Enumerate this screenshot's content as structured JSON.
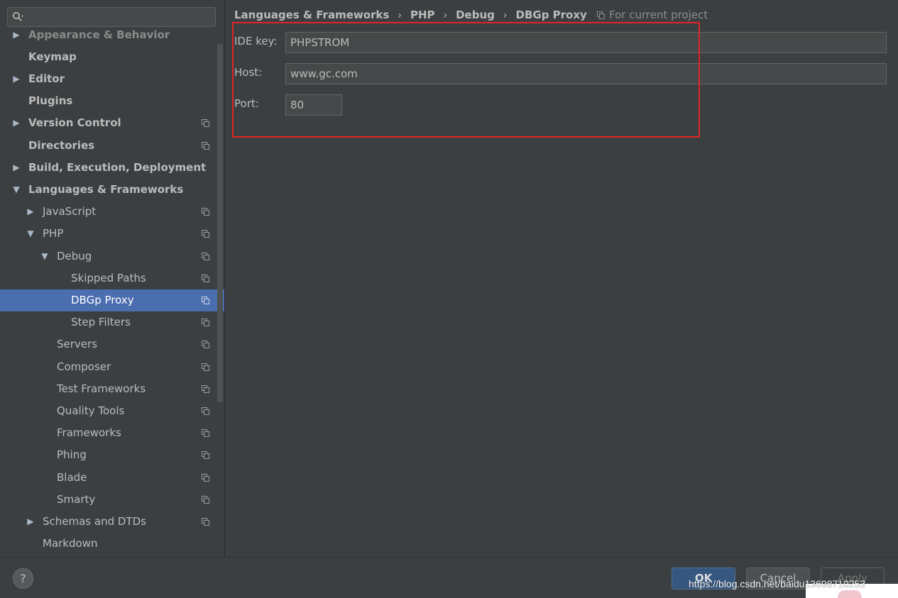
{
  "search": {
    "placeholder": ""
  },
  "sidebar": {
    "items": [
      {
        "label": "Appearance & Behavior",
        "arrow": "▶",
        "indent": 0,
        "bold": true,
        "proj": false,
        "cut": true
      },
      {
        "label": "Keymap",
        "arrow": "",
        "indent": 0,
        "bold": true,
        "proj": false
      },
      {
        "label": "Editor",
        "arrow": "▶",
        "indent": 0,
        "bold": true,
        "proj": false
      },
      {
        "label": "Plugins",
        "arrow": "",
        "indent": 0,
        "bold": true,
        "proj": false
      },
      {
        "label": "Version Control",
        "arrow": "▶",
        "indent": 0,
        "bold": true,
        "proj": true
      },
      {
        "label": "Directories",
        "arrow": "",
        "indent": 0,
        "bold": true,
        "proj": true
      },
      {
        "label": "Build, Execution, Deployment",
        "arrow": "▶",
        "indent": 0,
        "bold": true,
        "proj": false
      },
      {
        "label": "Languages & Frameworks",
        "arrow": "▼",
        "indent": 0,
        "bold": true,
        "proj": false
      },
      {
        "label": "JavaScript",
        "arrow": "▶",
        "indent": 1,
        "bold": false,
        "proj": true
      },
      {
        "label": "PHP",
        "arrow": "▼",
        "indent": 1,
        "bold": false,
        "proj": true
      },
      {
        "label": "Debug",
        "arrow": "▼",
        "indent": 2,
        "bold": false,
        "proj": true
      },
      {
        "label": "Skipped Paths",
        "arrow": "",
        "indent": 3,
        "bold": false,
        "proj": true
      },
      {
        "label": "DBGp Proxy",
        "arrow": "",
        "indent": 3,
        "bold": false,
        "proj": true,
        "selected": true
      },
      {
        "label": "Step Filters",
        "arrow": "",
        "indent": 3,
        "bold": false,
        "proj": true
      },
      {
        "label": "Servers",
        "arrow": "",
        "indent": 2,
        "bold": false,
        "proj": true
      },
      {
        "label": "Composer",
        "arrow": "",
        "indent": 2,
        "bold": false,
        "proj": true
      },
      {
        "label": "Test Frameworks",
        "arrow": "",
        "indent": 2,
        "bold": false,
        "proj": true
      },
      {
        "label": "Quality Tools",
        "arrow": "",
        "indent": 2,
        "bold": false,
        "proj": true
      },
      {
        "label": "Frameworks",
        "arrow": "",
        "indent": 2,
        "bold": false,
        "proj": true
      },
      {
        "label": "Phing",
        "arrow": "",
        "indent": 2,
        "bold": false,
        "proj": true
      },
      {
        "label": "Blade",
        "arrow": "",
        "indent": 2,
        "bold": false,
        "proj": true
      },
      {
        "label": "Smarty",
        "arrow": "",
        "indent": 2,
        "bold": false,
        "proj": true
      },
      {
        "label": "Schemas and DTDs",
        "arrow": "▶",
        "indent": 1,
        "bold": false,
        "proj": true
      },
      {
        "label": "Markdown",
        "arrow": "",
        "indent": 1,
        "bold": false,
        "proj": false
      }
    ]
  },
  "breadcrumb": {
    "items": [
      "Languages & Frameworks",
      "PHP",
      "Debug",
      "DBGp Proxy"
    ],
    "separator": "›",
    "scope": "For current project"
  },
  "form": {
    "ide_key": {
      "label": "IDE key:",
      "value": "PHPSTROM"
    },
    "host": {
      "label": "Host:",
      "value": "www.gc.com"
    },
    "port": {
      "label": "Port:",
      "value": "80"
    }
  },
  "buttons": {
    "help": "?",
    "ok": "OK",
    "cancel": "Cancel",
    "apply": "Apply"
  },
  "watermark": "https://blog.csdn.net/baidu13698710253",
  "colors": {
    "selection": "#4b6eaf",
    "highlight_box": "#e02424",
    "ok_button": "#365880"
  }
}
